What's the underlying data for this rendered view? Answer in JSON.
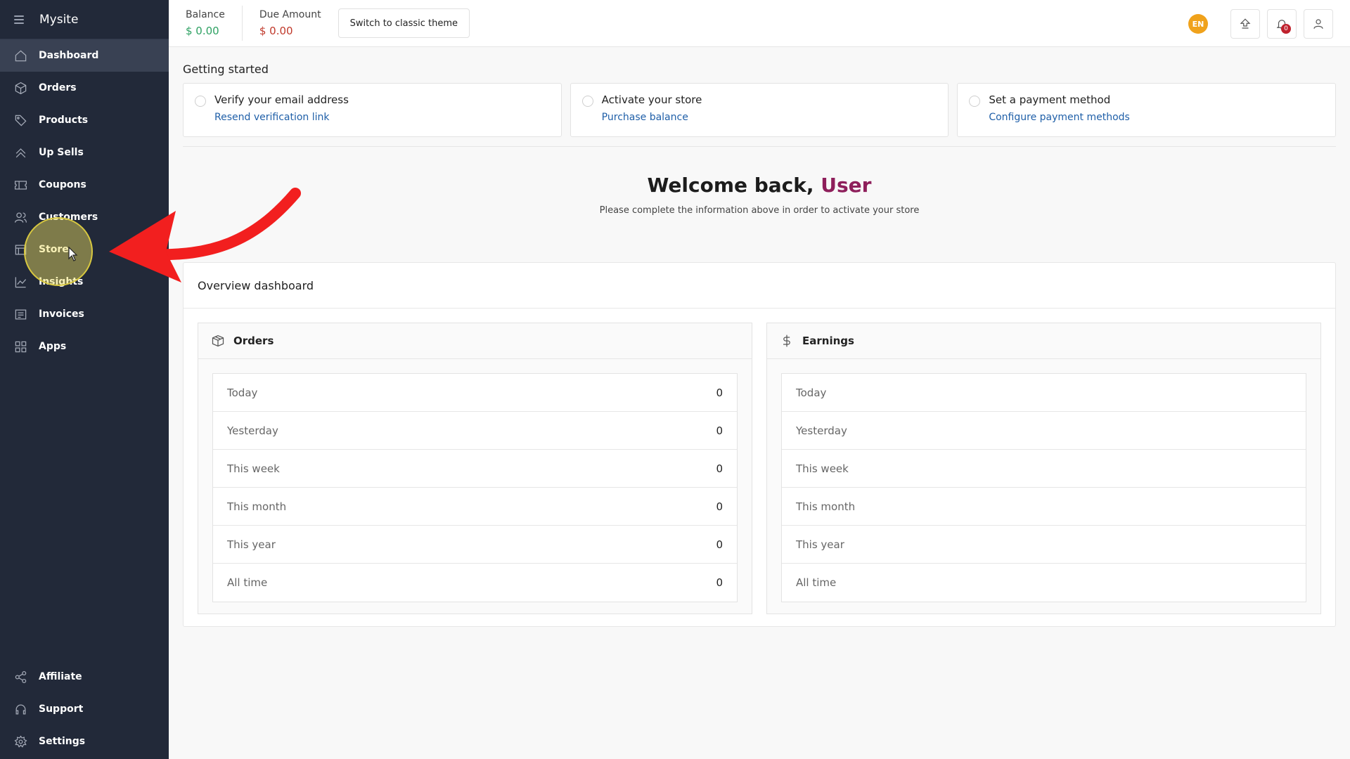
{
  "app": {
    "title": "Mysite"
  },
  "sidebar": {
    "items": [
      {
        "label": "Dashboard",
        "icon": "home-icon"
      },
      {
        "label": "Orders",
        "icon": "box-icon"
      },
      {
        "label": "Products",
        "icon": "tag-icon"
      },
      {
        "label": "Up Sells",
        "icon": "chevron-up-icon"
      },
      {
        "label": "Coupons",
        "icon": "ticket-icon"
      },
      {
        "label": "Customers",
        "icon": "users-icon"
      },
      {
        "label": "Store",
        "icon": "store-icon"
      },
      {
        "label": "Insights",
        "icon": "chart-icon"
      },
      {
        "label": "Invoices",
        "icon": "invoice-icon"
      },
      {
        "label": "Apps",
        "icon": "grid-icon"
      }
    ],
    "bottom": [
      {
        "label": "Affiliate",
        "icon": "share-icon"
      },
      {
        "label": "Support",
        "icon": "headset-icon"
      },
      {
        "label": "Settings",
        "icon": "gear-icon"
      }
    ]
  },
  "topbar": {
    "balance_label": "Balance",
    "balance_value": "$ 0.00",
    "due_label": "Due Amount",
    "due_value": "$ 0.00",
    "theme_button": "Switch to classic theme",
    "language": "EN",
    "notifications_count": "0"
  },
  "getting_started": {
    "title": "Getting started",
    "steps": [
      {
        "title": "Verify your email address",
        "link": "Resend verification link"
      },
      {
        "title": "Activate your store",
        "link": "Purchase balance"
      },
      {
        "title": "Set a payment method",
        "link": "Configure payment methods"
      }
    ]
  },
  "welcome": {
    "prefix": "Welcome back, ",
    "user": "User",
    "subtitle": "Please complete the information above in order to activate your store"
  },
  "overview": {
    "title": "Overview dashboard",
    "orders": {
      "title": "Orders",
      "rows": [
        {
          "label": "Today",
          "value": "0"
        },
        {
          "label": "Yesterday",
          "value": "0"
        },
        {
          "label": "This week",
          "value": "0"
        },
        {
          "label": "This month",
          "value": "0"
        },
        {
          "label": "This year",
          "value": "0"
        },
        {
          "label": "All time",
          "value": "0"
        }
      ]
    },
    "earnings": {
      "title": "Earnings",
      "rows": [
        {
          "label": "Today",
          "value": ""
        },
        {
          "label": "Yesterday",
          "value": ""
        },
        {
          "label": "This week",
          "value": ""
        },
        {
          "label": "This month",
          "value": ""
        },
        {
          "label": "This year",
          "value": ""
        },
        {
          "label": "All time",
          "value": ""
        }
      ]
    }
  },
  "colors": {
    "sidebar_bg": "#222939",
    "accent_user": "#8e1f5b",
    "link": "#1f5fa8",
    "balance": "#2ea163",
    "due": "#c0392b",
    "annotation_arrow": "#f21f1f",
    "cursor_highlight": "#f0e060"
  }
}
